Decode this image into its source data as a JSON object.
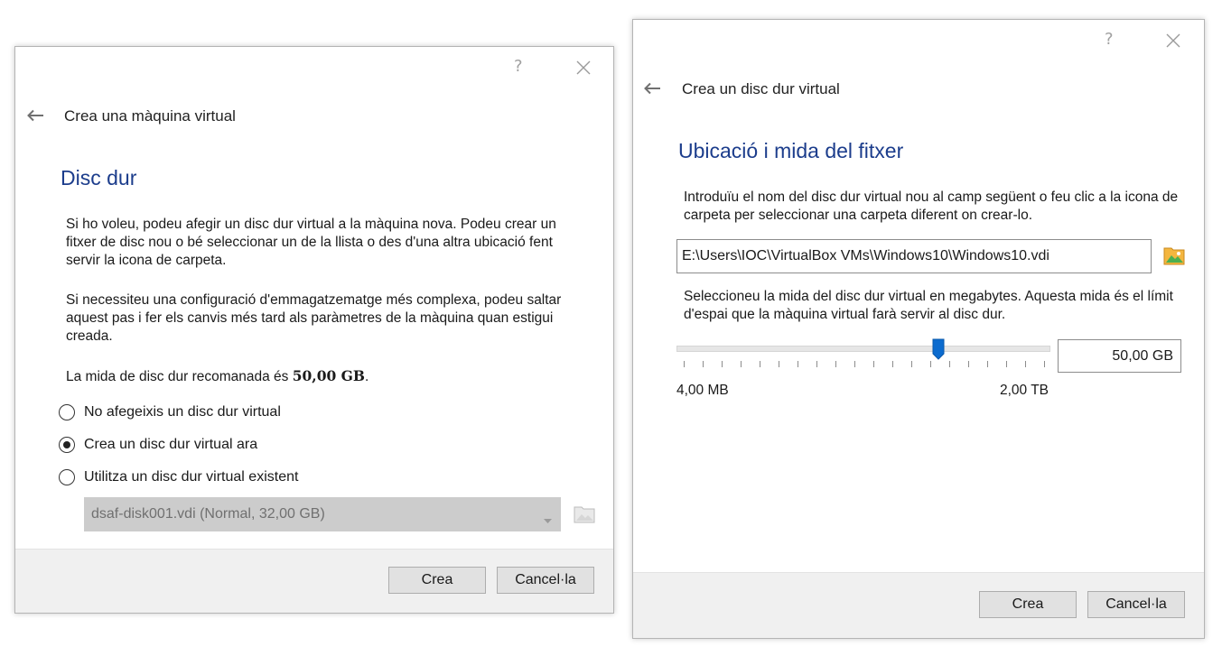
{
  "left_dialog": {
    "help_glyph": "?",
    "wizard_title": "Crea una màquina virtual",
    "section_title": "Disc dur",
    "paragraph1": "Si ho voleu, podeu afegir un disc dur virtual a la màquina nova. Podeu crear un fitxer de disc nou o bé seleccionar un de la llista o des d'una altra ubicació fent servir la icona de carpeta.",
    "paragraph2": "Si necessiteu una configuració d'emmagatzematge més complexa, podeu saltar aquest pas i fer els canvis més tard als paràmetres de la màquina quan estigui creada.",
    "recommended_prefix": "La mida de disc dur recomanada és ",
    "recommended_size": "50,00 GB",
    "recommended_suffix": ".",
    "radio_options": [
      {
        "label": "No afegeixis un disc dur virtual",
        "checked": false
      },
      {
        "label": "Crea un disc dur virtual ara",
        "checked": true
      },
      {
        "label": "Utilitza un disc dur virtual existent",
        "checked": false
      }
    ],
    "existing_disk_value": "dsaf-disk001.vdi (Normal, 32,00 GB)",
    "create_button": "Crea",
    "cancel_button": "Cancel·la"
  },
  "right_dialog": {
    "help_glyph": "?",
    "wizard_title": "Crea un disc dur virtual",
    "section_title": "Ubicació i mida del fitxer",
    "location_description": "Introduïu el nom del disc dur virtual nou al camp següent o feu clic a la icona de carpeta per seleccionar una carpeta diferent on crear-lo.",
    "file_path": "E:\\Users\\IOC\\VirtualBox VMs\\Windows10\\Windows10.vdi",
    "size_description": "Seleccioneu la mida del disc dur virtual en megabytes. Aquesta mida és el límit d'espai que la màquina virtual farà servir al disc dur.",
    "slider_position_fraction": 0.7,
    "size_value": "50,00 GB",
    "min_label": "4,00 MB",
    "max_label": "2,00 TB",
    "create_button": "Crea",
    "cancel_button": "Cancel·la"
  },
  "colors": {
    "section_title": "#1c3d8c",
    "slider_thumb": "#0b6bcf",
    "footer_bg": "#f0f0f0",
    "folder_icon": "#f4b63f"
  },
  "icons": [
    "back-arrow-icon",
    "help-icon",
    "close-icon",
    "folder-icon",
    "dropdown-arrow-icon",
    "slider-thumb"
  ]
}
